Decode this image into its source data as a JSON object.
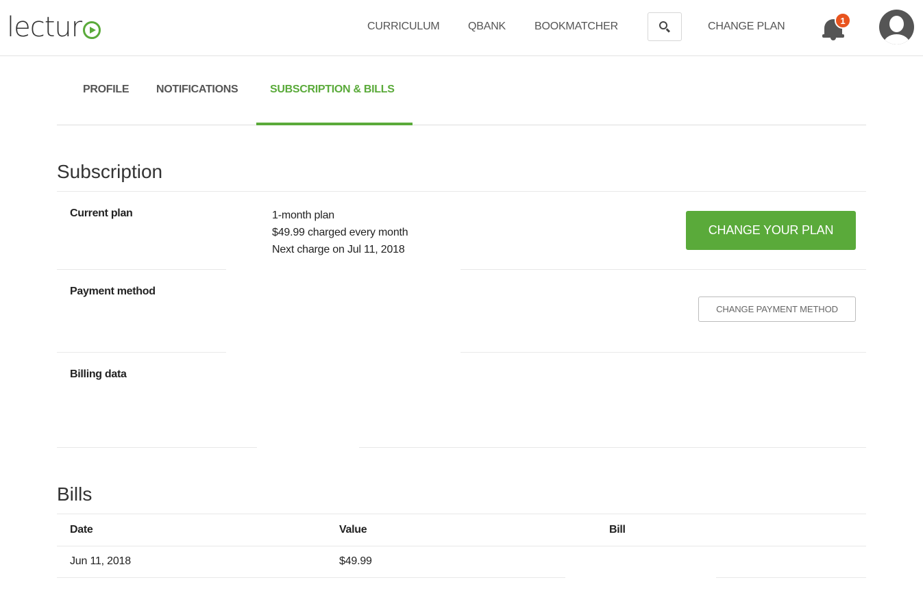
{
  "header": {
    "logo_text": "lectur",
    "nav": [
      {
        "label": "CURRICULUM"
      },
      {
        "label": "QBANK"
      },
      {
        "label": "BOOKMATCHER"
      }
    ],
    "change_plan_label": "CHANGE PLAN",
    "notifications_count": "1",
    "search_icon": "search-icon",
    "bell_icon": "bell-icon",
    "avatar_icon": "user-avatar-icon"
  },
  "tabs": [
    {
      "label": "PROFILE",
      "active": false
    },
    {
      "label": "NOTIFICATIONS",
      "active": false
    },
    {
      "label": "SUBSCRIPTION & BILLS",
      "active": true
    }
  ],
  "subscription": {
    "title": "Subscription",
    "current_plan": {
      "label": "Current plan",
      "plan_name": "1-month plan",
      "charge": "$49.99 charged every month",
      "next_charge": "Next charge on Jul 11, 2018",
      "button": "CHANGE YOUR PLAN"
    },
    "payment_method": {
      "label": "Payment method",
      "button": "CHANGE PAYMENT METHOD"
    },
    "billing_data": {
      "label": "Billing data"
    }
  },
  "bills": {
    "title": "Bills",
    "columns": [
      "Date",
      "Value",
      "Bill"
    ],
    "rows": [
      {
        "date": "Jun 11, 2018",
        "value": "$49.99",
        "bill": ""
      }
    ]
  },
  "colors": {
    "accent": "#5aaa3a",
    "badge": "#e8541e"
  }
}
